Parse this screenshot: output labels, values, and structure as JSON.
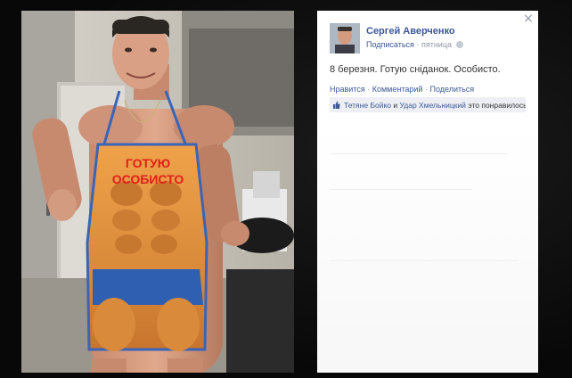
{
  "post": {
    "author_name": "Сергей Аверченко",
    "subscribe_label": "Подписаться",
    "separator": "·",
    "time_label": "пятница",
    "text": "8 березня. Готую сніданок. Особисто.",
    "actions": {
      "like": "Нравится",
      "comment": "Комментарий",
      "share": "Поделиться",
      "dot": "·"
    },
    "likes": {
      "person1": "Тетяне Бойко",
      "conj": "и",
      "person2": "Удар Хмельницкий",
      "suffix": "это понравилось."
    }
  },
  "photo": {
    "apron_text_line1": "ГОТУЮ",
    "apron_text_line2": "ОСОБИСТО"
  },
  "viewer": {
    "close_symbol": "×"
  },
  "colors": {
    "link": "#3b5998",
    "meta": "#9197a3",
    "likes_bg": "#edeff4",
    "apron_text": "#e0201a"
  }
}
